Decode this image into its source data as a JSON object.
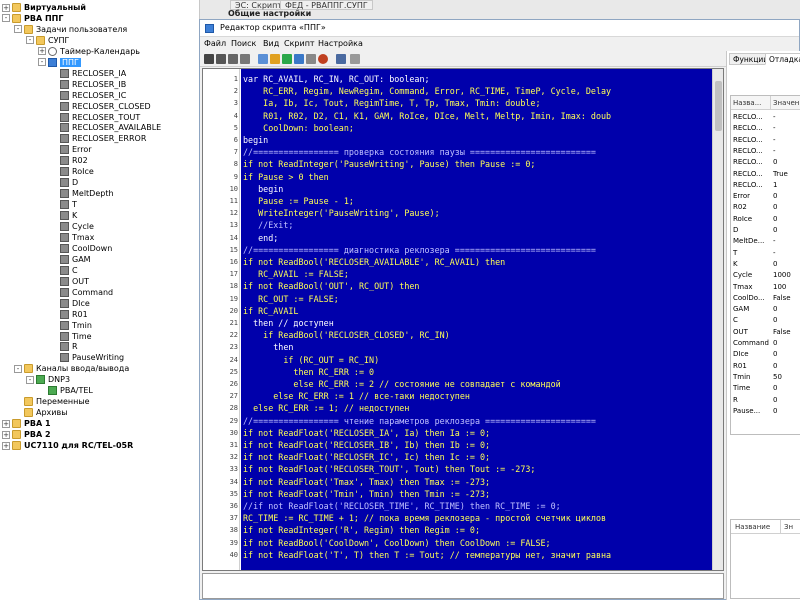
{
  "tree": {
    "items": [
      {
        "label": "Виртуальный",
        "level": 0,
        "icon": "folder",
        "exp": "+",
        "bold": true
      },
      {
        "label": "РВА ППГ",
        "level": 0,
        "icon": "folder",
        "exp": "-",
        "bold": true
      },
      {
        "label": "Задачи пользователя",
        "level": 1,
        "icon": "folder",
        "exp": "-"
      },
      {
        "label": "СУПГ",
        "level": 2,
        "icon": "folder",
        "exp": "-"
      },
      {
        "label": "Таймер-Календарь",
        "level": 3,
        "icon": "clock",
        "exp": "+"
      },
      {
        "label": "ППГ",
        "level": 3,
        "icon": "blue",
        "exp": "-",
        "selected": true
      },
      {
        "label": "RECLOSER_IA",
        "level": 4,
        "icon": "var"
      },
      {
        "label": "RECLOSER_IB",
        "level": 4,
        "icon": "var"
      },
      {
        "label": "RECLOSER_IC",
        "level": 4,
        "icon": "var"
      },
      {
        "label": "RECLOSER_CLOSED",
        "level": 4,
        "icon": "var"
      },
      {
        "label": "RECLOSER_TOUT",
        "level": 4,
        "icon": "var"
      },
      {
        "label": "RECLOSER_AVAILABLE",
        "level": 4,
        "icon": "var"
      },
      {
        "label": "RECLOSER_ERROR",
        "level": 4,
        "icon": "var"
      },
      {
        "label": "Error",
        "level": 4,
        "icon": "var"
      },
      {
        "label": "R02",
        "level": 4,
        "icon": "var"
      },
      {
        "label": "RoIce",
        "level": 4,
        "icon": "var"
      },
      {
        "label": "D",
        "level": 4,
        "icon": "var"
      },
      {
        "label": "MeltDepth",
        "level": 4,
        "icon": "var"
      },
      {
        "label": "T",
        "level": 4,
        "icon": "var"
      },
      {
        "label": "K",
        "level": 4,
        "icon": "var"
      },
      {
        "label": "Cycle",
        "level": 4,
        "icon": "var"
      },
      {
        "label": "Tmax",
        "level": 4,
        "icon": "var"
      },
      {
        "label": "CoolDown",
        "level": 4,
        "icon": "var"
      },
      {
        "label": "GAM",
        "level": 4,
        "icon": "var"
      },
      {
        "label": "C",
        "level": 4,
        "icon": "var"
      },
      {
        "label": "OUT",
        "level": 4,
        "icon": "var"
      },
      {
        "label": "Command",
        "level": 4,
        "icon": "var"
      },
      {
        "label": "DIce",
        "level": 4,
        "icon": "var"
      },
      {
        "label": "R01",
        "level": 4,
        "icon": "var"
      },
      {
        "label": "Tmin",
        "level": 4,
        "icon": "var"
      },
      {
        "label": "Time",
        "level": 4,
        "icon": "var"
      },
      {
        "label": "R",
        "level": 4,
        "icon": "var"
      },
      {
        "label": "PauseWriting",
        "level": 4,
        "icon": "var"
      },
      {
        "label": "Каналы ввода/вывода",
        "level": 1,
        "icon": "folder",
        "exp": "-"
      },
      {
        "label": "DNP3",
        "level": 2,
        "icon": "green",
        "exp": "-"
      },
      {
        "label": "PBA/TEL",
        "level": 3,
        "icon": "green"
      },
      {
        "label": "Переменные",
        "level": 1,
        "icon": "folder"
      },
      {
        "label": "Архивы",
        "level": 1,
        "icon": "folder"
      },
      {
        "label": "РВА 1",
        "level": 0,
        "icon": "folder",
        "exp": "+",
        "bold": true
      },
      {
        "label": "РВА 2",
        "level": 0,
        "icon": "folder",
        "exp": "+",
        "bold": true
      },
      {
        "label": "UC7110 для RC/TEL-05R",
        "level": 0,
        "icon": "folder",
        "exp": "+",
        "bold": true
      }
    ]
  },
  "background": {
    "tabs": [
      "ЭС: Скрипт",
      "ФЕД - РВАППГ.СУПГ"
    ],
    "subtitle": "Общие настройки"
  },
  "window": {
    "title": "Редактор скрипта «ППГ»",
    "menu": [
      "Файл",
      "Поиск",
      "Вид",
      "Скрипт",
      "Настройка"
    ]
  },
  "editor": {
    "lines": [
      {
        "n": "1",
        "t": "var RC_AVAIL, RC_IN, RC_OUT: boolean;",
        "c": "kw"
      },
      {
        "n": "2",
        "t": "    RC_ERR, Regim, NewRegim, Command, Error, RC_TIME, TimeP, Cycle, Delay",
        "c": ""
      },
      {
        "n": "3",
        "t": "    Ia, Ib, Ic, Tout, RegimTime, T, Tp, Tmax, Tmin: double;",
        "c": ""
      },
      {
        "n": "4",
        "t": "    R01, R02, D2, C1, K1, GAM, RoIce, DIce, Melt, Meltp, Imin, Imax: doub",
        "c": ""
      },
      {
        "n": "5",
        "t": "    CoolDown: boolean;",
        "c": ""
      },
      {
        "n": "6",
        "t": "begin",
        "c": "kw"
      },
      {
        "n": "7",
        "t": "//================= проверка состояния паузы =========================",
        "c": "cm"
      },
      {
        "n": "8",
        "t": "if not ReadInteger('PauseWriting', Pause) then Pause := 0;",
        "c": ""
      },
      {
        "n": "9",
        "t": "if Pause > 0 then",
        "c": ""
      },
      {
        "n": "10",
        "t": "   begin",
        "c": "kw"
      },
      {
        "n": "11",
        "t": "   Pause := Pause - 1;",
        "c": ""
      },
      {
        "n": "12",
        "t": "   WriteInteger('PauseWriting', Pause);",
        "c": ""
      },
      {
        "n": "13",
        "t": "   //Exit;",
        "c": "cm"
      },
      {
        "n": "14",
        "t": "   end;",
        "c": "kw"
      },
      {
        "n": "15",
        "t": "//================= диагностика реклозера ============================",
        "c": "cm"
      },
      {
        "n": "16",
        "t": "if not ReadBool('RECLOSER_AVAILABLE', RC_AVAIL) then",
        "c": ""
      },
      {
        "n": "17",
        "t": "   RC_AVAIL := FALSE;",
        "c": ""
      },
      {
        "n": "18",
        "t": "if not ReadBool('OUT', RC_OUT) then",
        "c": ""
      },
      {
        "n": "19",
        "t": "   RC_OUT := FALSE;",
        "c": ""
      },
      {
        "n": "20",
        "t": "if RC_AVAIL",
        "c": ""
      },
      {
        "n": "21",
        "t": "  then // доступен",
        "c": "kw"
      },
      {
        "n": "22",
        "t": "    if ReadBool('RECLOSER_CLOSED', RC_IN)",
        "c": ""
      },
      {
        "n": "23",
        "t": "      then",
        "c": "kw"
      },
      {
        "n": "24",
        "t": "        if (RC_OUT = RC_IN)",
        "c": ""
      },
      {
        "n": "25",
        "t": "          then RC_ERR := 0",
        "c": ""
      },
      {
        "n": "26",
        "t": "          else RC_ERR := 2 // состояние не совпадает с командой",
        "c": ""
      },
      {
        "n": "27",
        "t": "      else RC_ERR := 1 // все-таки недоступен",
        "c": ""
      },
      {
        "n": "28",
        "t": "  else RC_ERR := 1; // недоступен",
        "c": ""
      },
      {
        "n": "29",
        "t": "//================= чтение параметров реклозера ======================",
        "c": "cm"
      },
      {
        "n": "30",
        "t": "if not ReadFloat('RECLOSER_IA', Ia) then Ia := 0;",
        "c": ""
      },
      {
        "n": "31",
        "t": "if not ReadFloat('RECLOSER_IB', Ib) then Ib := 0;",
        "c": ""
      },
      {
        "n": "32",
        "t": "if not ReadFloat('RECLOSER_IC', Ic) then Ic := 0;",
        "c": ""
      },
      {
        "n": "33",
        "t": "if not ReadFloat('RECLOSER_TOUT', Tout) then Tout := -273;",
        "c": ""
      },
      {
        "n": "34",
        "t": "if not ReadFloat('Tmax', Tmax) then Tmax := -273;",
        "c": ""
      },
      {
        "n": "35",
        "t": "if not ReadFloat('Tmin', Tmin) then Tmin := -273;",
        "c": ""
      },
      {
        "n": "36",
        "t": "//if not ReadFloat('RECLOSER_TIME', RC_TIME) then RC_TIME := 0;",
        "c": "cm"
      },
      {
        "n": "37",
        "t": "RC_TIME := RC_TIME + 1; // пока время реклозера - простой счетчик циклов",
        "c": ""
      },
      {
        "n": "38",
        "t": "if not ReadInteger('R', Regim) then Regim := 0;",
        "c": ""
      },
      {
        "n": "39",
        "t": "if not ReadBool('CoolDown', CoolDown) then CoolDown := FALSE;",
        "c": ""
      },
      {
        "n": "40",
        "t": "if not ReadFloat('T', T) then T := Tout; // температуры нет, значит равна",
        "c": ""
      }
    ]
  },
  "rpanel": {
    "tabs": [
      "Функции",
      "Отладка"
    ],
    "active_tab": "Отладка",
    "var_headers": [
      "Назва...",
      "Значение"
    ],
    "vars": [
      {
        "name": "RECLO...",
        "value": "-"
      },
      {
        "name": "RECLO...",
        "value": "-"
      },
      {
        "name": "RECLO...",
        "value": "-"
      },
      {
        "name": "RECLO...",
        "value": "-"
      },
      {
        "name": "RECLO...",
        "value": "0"
      },
      {
        "name": "RECLO...",
        "value": "True"
      },
      {
        "name": "RECLO...",
        "value": "1"
      },
      {
        "name": "Error",
        "value": "0"
      },
      {
        "name": "R02",
        "value": "0"
      },
      {
        "name": "RoIce",
        "value": "0"
      },
      {
        "name": "D",
        "value": "0"
      },
      {
        "name": "MeltDe...",
        "value": "-"
      },
      {
        "name": "T",
        "value": "-"
      },
      {
        "name": "K",
        "value": "0"
      },
      {
        "name": "Cycle",
        "value": "1000"
      },
      {
        "name": "Tmax",
        "value": "100"
      },
      {
        "name": "CoolDo...",
        "value": "False"
      },
      {
        "name": "GAM",
        "value": "0"
      },
      {
        "name": "C",
        "value": "0"
      },
      {
        "name": "OUT",
        "value": "False"
      },
      {
        "name": "Command",
        "value": "0"
      },
      {
        "name": "DIce",
        "value": "0"
      },
      {
        "name": "R01",
        "value": "0"
      },
      {
        "name": "Tmin",
        "value": "50"
      },
      {
        "name": "Time",
        "value": "0"
      },
      {
        "name": "R",
        "value": "0"
      },
      {
        "name": "Pause...",
        "value": "0"
      }
    ],
    "bottom_headers": [
      "Название",
      "Зн"
    ]
  }
}
